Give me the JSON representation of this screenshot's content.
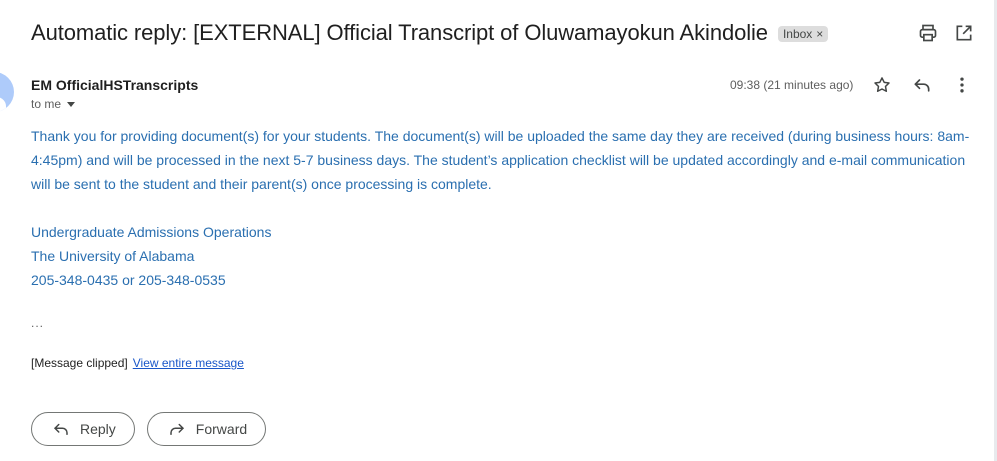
{
  "email": {
    "subject": "Automatic reply: [EXTERNAL] Official Transcript of Oluwamayokun Akindolie",
    "label": "Inbox",
    "label_remove": "×",
    "sender": "EM OfficialHSTranscripts",
    "recipient": "to me",
    "timestamp": "09:38 (21 minutes ago)",
    "body": "Thank you for providing document(s) for your students. The document(s) will be uploaded the same day they are received (during business hours: 8am-4:45pm) and will be processed in the next 5-7 business days. The student’s application checklist will be updated accordingly and e-mail communication will be sent to the student and their parent(s) once processing is complete.",
    "signature": {
      "line1": "Undergraduate Admissions Operations",
      "line2": "The University of Alabama",
      "line3": "205-348-0435 or 205-348-0535"
    },
    "ellipsis": "...",
    "clipped_text": "[Message clipped]",
    "view_entire_link": "View entire message"
  },
  "actions": {
    "reply_label": "Reply",
    "forward_label": "Forward"
  },
  "icons": {
    "print": "print-icon",
    "open_new_window": "open-in-new-window-icon",
    "star": "star-icon",
    "reply": "reply-icon",
    "more": "more-vert-icon",
    "forward": "forward-icon"
  }
}
